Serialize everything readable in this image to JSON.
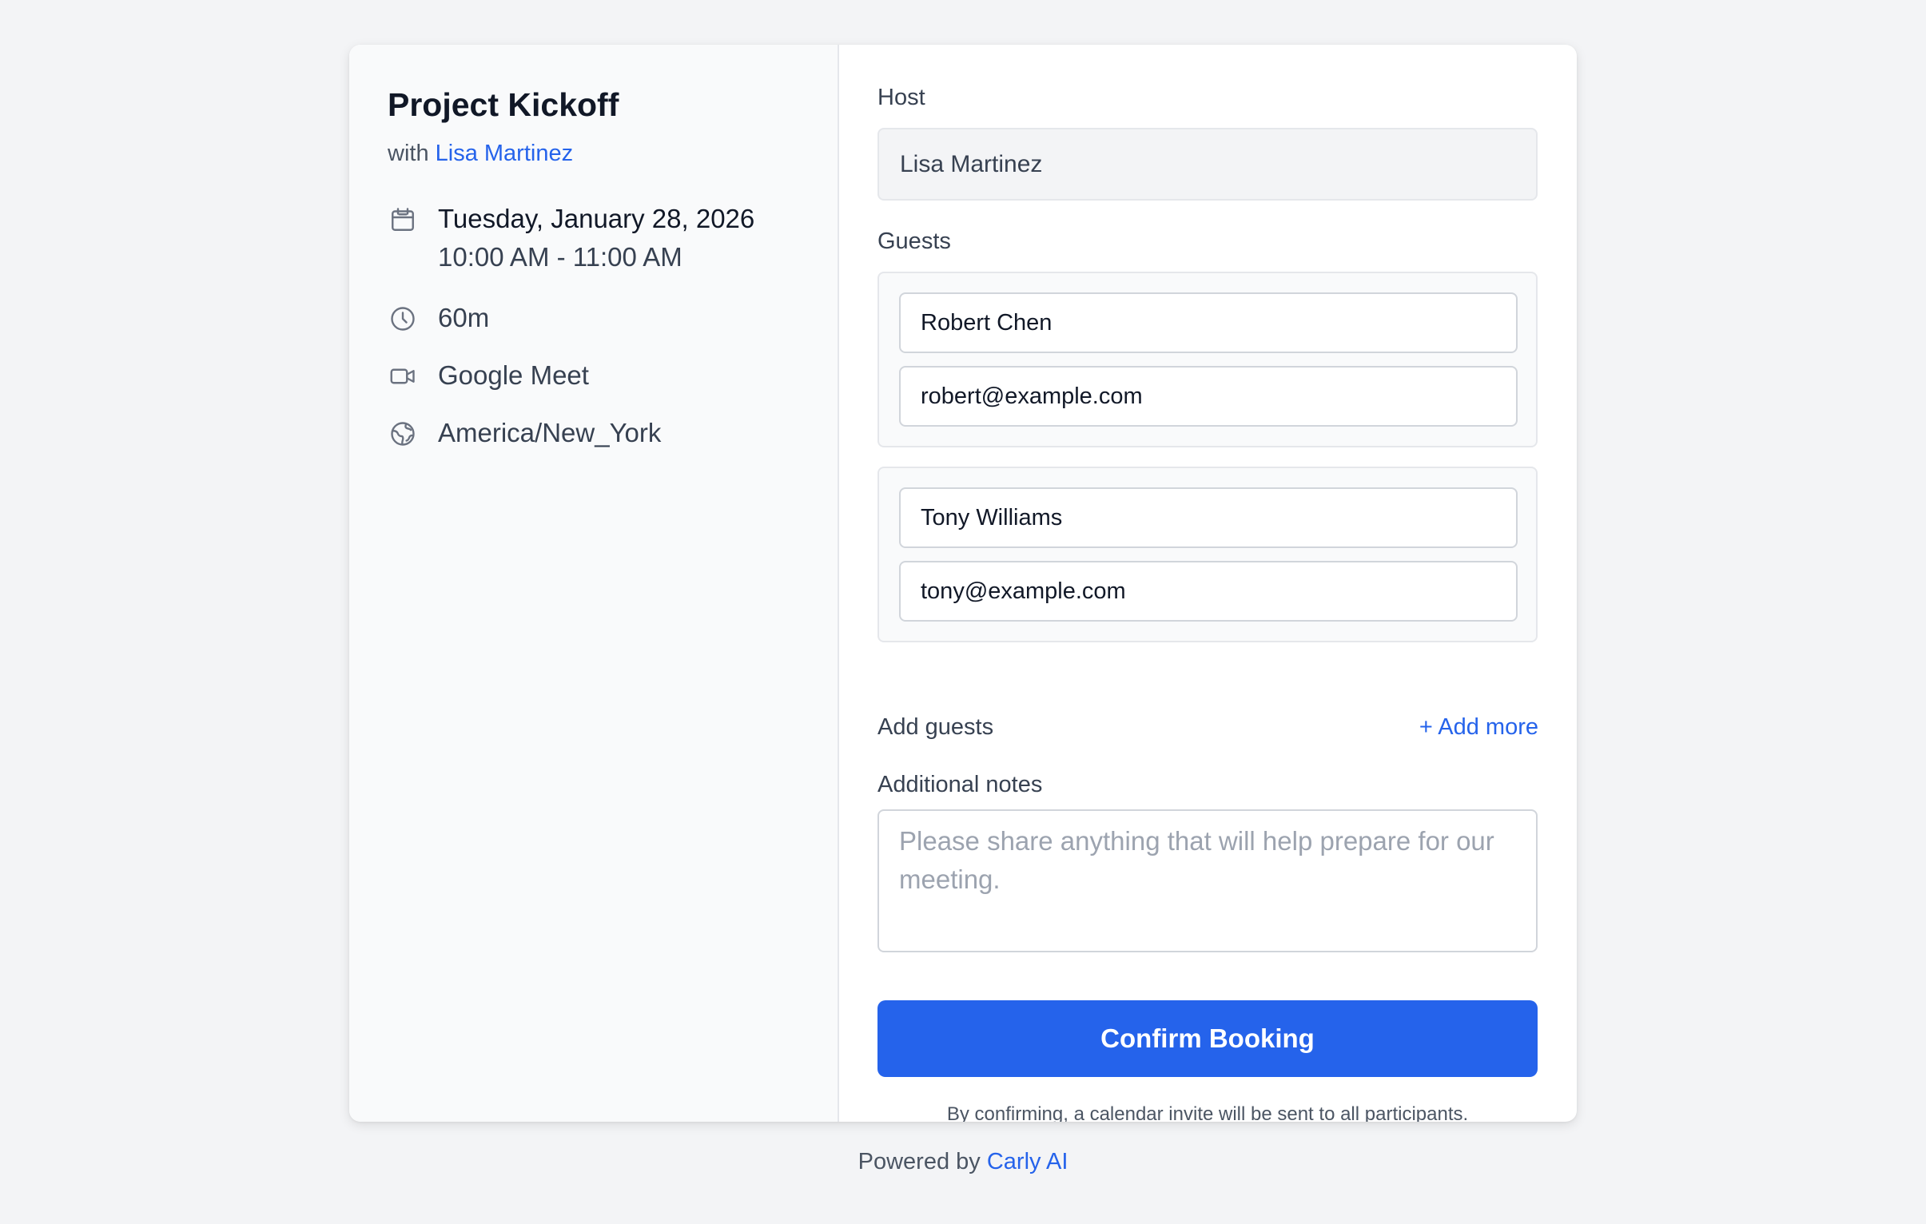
{
  "event": {
    "title": "Project Kickoff",
    "with_prefix": "with",
    "host_name": "Lisa Martinez",
    "date": "Tuesday, January 28, 2026",
    "time": "10:00 AM - 11:00 AM",
    "duration": "60m",
    "location": "Google Meet",
    "timezone": "America/New_York"
  },
  "form": {
    "host_label": "Host",
    "host_value": "Lisa Martinez",
    "guests_label": "Guests",
    "guests": [
      {
        "name": "Robert Chen",
        "email": "robert@example.com"
      },
      {
        "name": "Tony Williams",
        "email": "tony@example.com"
      }
    ],
    "add_guests_label": "Add guests",
    "add_more_label": "+ Add more",
    "notes_label": "Additional notes",
    "notes_placeholder": "Please share anything that will help prepare for our meeting.",
    "notes_value": "",
    "confirm_label": "Confirm Booking",
    "disclaimer": "By confirming, a calendar invite will be sent to all participants."
  },
  "footer": {
    "prefix": "Powered by",
    "brand": "Carly AI"
  },
  "icons": {
    "date": "calendar-icon",
    "duration": "clock-icon",
    "location": "video-camera-icon",
    "timezone": "globe-icon"
  },
  "colors": {
    "accent": "#2563eb",
    "page_bg": "#f3f4f6",
    "panel_bg": "#f9fafb"
  }
}
